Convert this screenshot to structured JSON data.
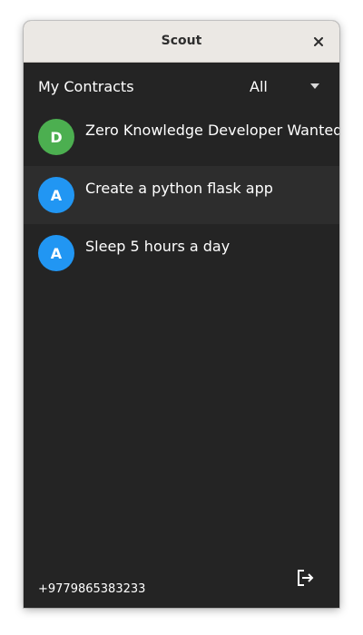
{
  "window": {
    "title": "Scout"
  },
  "header": {
    "title": "My Contracts",
    "filter_value": "All"
  },
  "contracts": [
    {
      "avatar_letter": "D",
      "avatar_color": "#4caf50",
      "title": "Zero Knowledge Developer Wanted",
      "selected": false
    },
    {
      "avatar_letter": "A",
      "avatar_color": "#2196f3",
      "title": "Create a python flask app",
      "selected": true
    },
    {
      "avatar_letter": "A",
      "avatar_color": "#2196f3",
      "title": "Sleep 5 hours a day",
      "selected": false
    }
  ],
  "footer": {
    "phone": "+9779865383233"
  },
  "icons": {
    "close": "close-icon",
    "dropdown": "chevron-down-icon",
    "logout": "logout-icon"
  }
}
